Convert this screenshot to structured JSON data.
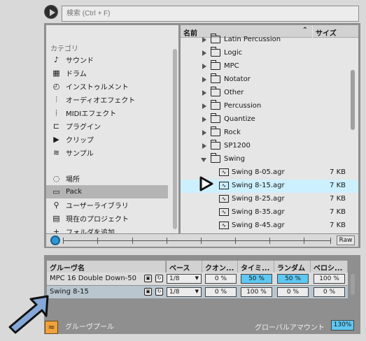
{
  "search": {
    "placeholder": "検索 (Ctrl + F)"
  },
  "sidebar": {
    "title": "カテゴリ",
    "items": [
      {
        "label": "サウンド",
        "icon": "sound-icon"
      },
      {
        "label": "ドラム",
        "icon": "drum-icon"
      },
      {
        "label": "インストゥルメント",
        "icon": "instrument-icon"
      },
      {
        "label": "オーディオエフェクト",
        "icon": "audio-effect-icon"
      },
      {
        "label": "MIDIエフェクト",
        "icon": "midi-effect-icon"
      },
      {
        "label": "プラグイン",
        "icon": "plugin-icon"
      },
      {
        "label": "クリップ",
        "icon": "clip-icon"
      },
      {
        "label": "サンプル",
        "icon": "sample-icon"
      }
    ],
    "places": [
      {
        "label": "場所",
        "icon": "places-icon"
      },
      {
        "label": "Pack",
        "icon": "pack-icon",
        "selected": true
      },
      {
        "label": "ユーザーライブラリ",
        "icon": "user-library-icon"
      },
      {
        "label": "現在のプロジェクト",
        "icon": "current-project-icon"
      },
      {
        "label": "フォルダを追加...",
        "icon": "add-folder-icon"
      }
    ]
  },
  "files": {
    "col_name": "名前",
    "col_size": "サイズ",
    "rows": [
      {
        "name": "Latin Percussion",
        "type": "folder"
      },
      {
        "name": "Logic",
        "type": "folder"
      },
      {
        "name": "MPC",
        "type": "folder"
      },
      {
        "name": "Notator",
        "type": "folder"
      },
      {
        "name": "Other",
        "type": "folder"
      },
      {
        "name": "Percussion",
        "type": "folder"
      },
      {
        "name": "Quantize",
        "type": "folder"
      },
      {
        "name": "Rock",
        "type": "folder"
      },
      {
        "name": "SP1200",
        "type": "folder"
      },
      {
        "name": "Swing",
        "type": "folder-open"
      },
      {
        "name": "Swing 8-05.agr",
        "type": "groove",
        "size": "7 KB"
      },
      {
        "name": "Swing 8-15.agr",
        "type": "groove",
        "size": "7 KB",
        "selected": true
      },
      {
        "name": "Swing 8-25.agr",
        "type": "groove",
        "size": "7 KB"
      },
      {
        "name": "Swing 8-35.agr",
        "type": "groove",
        "size": "7 KB"
      },
      {
        "name": "Swing 8-45.agr",
        "type": "groove",
        "size": "7 KB"
      }
    ]
  },
  "hotswap": {
    "raw_label": "Raw"
  },
  "groove_pool": {
    "headers": [
      "グルーヴ名",
      "ベース",
      "クオン...",
      "タイミ...",
      "ランダム",
      "ベロシ..."
    ],
    "rows": [
      {
        "name": "MPC 16 Double Down-50",
        "base": "1/8",
        "quantize": "0 %",
        "timing": "50 %",
        "random": "50 %",
        "velocity": "100 %"
      },
      {
        "name": "Swing 8-15",
        "base": "1/8",
        "quantize": "0 %",
        "timing": "100 %",
        "random": "0 %",
        "velocity": "0 %"
      }
    ],
    "footer_label": "グルーヴプール",
    "global_label": "グローバルアマウント",
    "global_value": "130%"
  },
  "colors": {
    "accent": "#5ec8f2",
    "selection": "#cdf0ff",
    "arrow": "#86a8d8"
  }
}
